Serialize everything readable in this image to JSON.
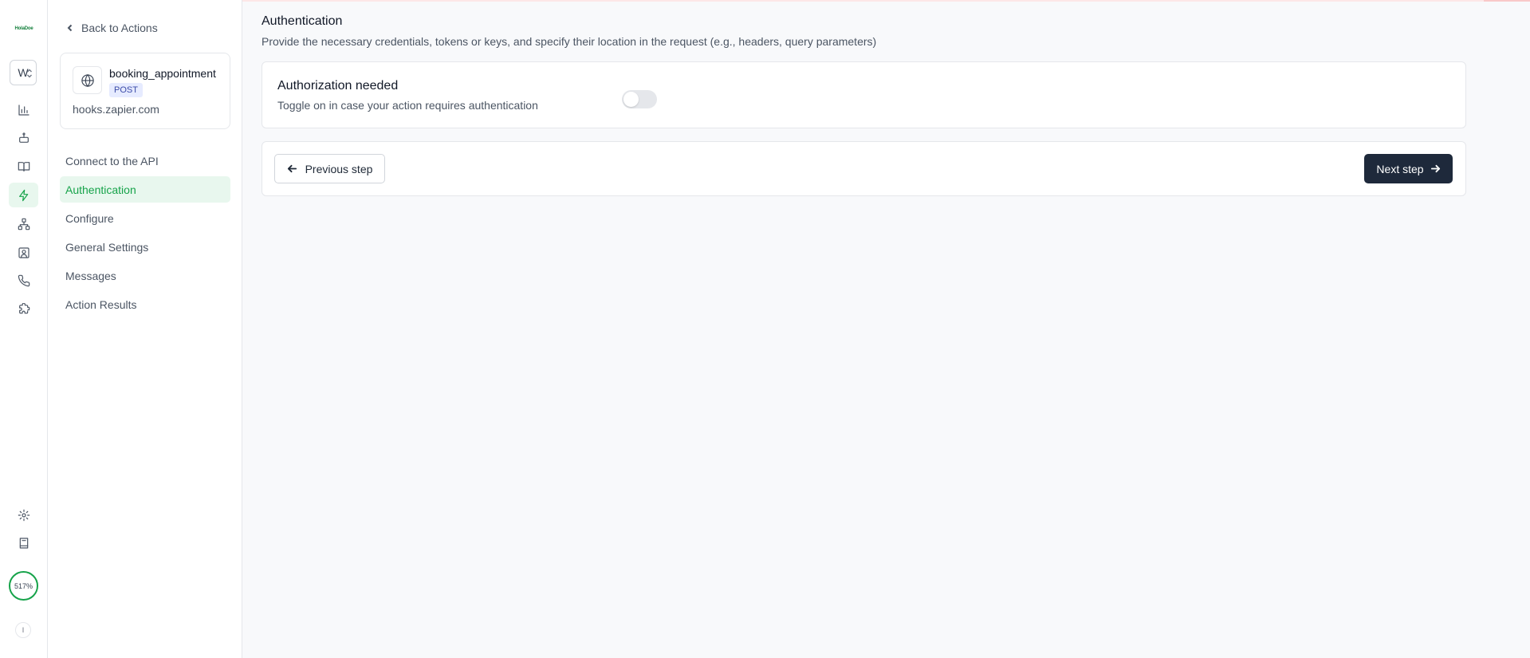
{
  "rail": {
    "logo_text": "HolaDoe",
    "workspace_initial": "W",
    "nav_icons": [
      "bar-chart-icon",
      "bot-icon",
      "book-open-icon",
      "zap-icon",
      "network-icon",
      "contact-icon",
      "phone-icon",
      "puzzle-icon"
    ],
    "active_icon": "zap-icon",
    "bottom_icons": [
      "settings-icon",
      "book-icon"
    ],
    "usage_label": "517%",
    "user_initial": "I"
  },
  "sidebar": {
    "back_label": "Back to Actions",
    "action": {
      "name": "booking_appointment",
      "method": "POST",
      "host": "hooks.zapier.com"
    },
    "steps": [
      {
        "label": "Connect to the API",
        "active": false
      },
      {
        "label": "Authentication",
        "active": true
      },
      {
        "label": "Configure",
        "active": false
      },
      {
        "label": "General Settings",
        "active": false
      },
      {
        "label": "Messages",
        "active": false
      },
      {
        "label": "Action Results",
        "active": false
      }
    ]
  },
  "main": {
    "title": "Authentication",
    "description": "Provide the necessary credentials, tokens or keys, and specify their location in the request (e.g., headers, query parameters)",
    "auth": {
      "title": "Authorization needed",
      "help": "Toggle on in case your action requires authentication",
      "enabled": false
    },
    "nav": {
      "prev_label": "Previous step",
      "next_label": "Next step"
    }
  },
  "colors": {
    "accent": "#16a34a",
    "accent_bg": "#e8f7ee",
    "primary_button": "#1e293b",
    "badge_bg": "#e6ebff"
  }
}
